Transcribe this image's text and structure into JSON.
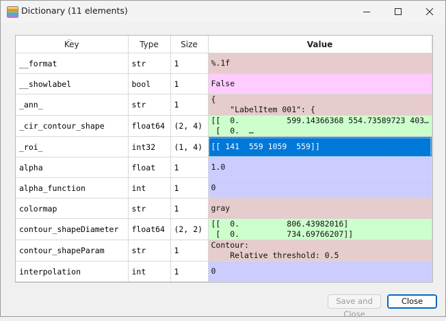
{
  "window": {
    "title": "Dictionary (11 elements)",
    "minimize_icon": "minimize-icon",
    "maximize_icon": "maximize-icon",
    "close_icon": "close-icon"
  },
  "table": {
    "headers": {
      "key": "Key",
      "type": "Type",
      "size": "Size",
      "value": "Value"
    },
    "rows": [
      {
        "key": "__format",
        "type": "str",
        "size": "1",
        "value": [
          "%.1f"
        ],
        "bg": "#e6cccc"
      },
      {
        "key": "__showlabel",
        "type": "bool",
        "size": "1",
        "value": [
          "False"
        ],
        "bg": "#ffccff"
      },
      {
        "key": "_ann_",
        "type": "str",
        "size": "1",
        "value": [
          "{",
          "    \"LabelItem 001\": {"
        ],
        "bg": "#e6cccc"
      },
      {
        "key": "_cir_contour_shape",
        "type": "float64",
        "size": "(2, 4)",
        "value": [
          "[[  0.          599.14366368 554.73589723 403…",
          " [  0.  …"
        ],
        "bg": "#ccffcc"
      },
      {
        "key": "_roi_",
        "type": "int32",
        "size": "(1, 4)",
        "value": [
          "[[ 141  559 1059  559]]"
        ],
        "bg": "#0078d7",
        "selected": true
      },
      {
        "key": "alpha",
        "type": "float",
        "size": "1",
        "value": [
          "1.0"
        ],
        "bg": "#ccccff"
      },
      {
        "key": "alpha_function",
        "type": "int",
        "size": "1",
        "value": [
          "0"
        ],
        "bg": "#ccccff"
      },
      {
        "key": "colormap",
        "type": "str",
        "size": "1",
        "value": [
          "gray"
        ],
        "bg": "#e6cccc"
      },
      {
        "key": "contour_shapeDiameter",
        "type": "float64",
        "size": "(2, 2)",
        "value": [
          "[[  0.          806.43982016]",
          " [  0.          734.69766207]]"
        ],
        "bg": "#ccffcc"
      },
      {
        "key": "contour_shapeParam",
        "type": "str",
        "size": "1",
        "value": [
          "Contour:",
          "    Relative threshold: 0.5"
        ],
        "bg": "#e6cccc"
      },
      {
        "key": "interpolation",
        "type": "int",
        "size": "1",
        "value": [
          "0"
        ],
        "bg": "#ccccff"
      }
    ]
  },
  "buttons": {
    "save_and_close": "Save and Close",
    "close": "Close"
  },
  "colors": {
    "accent": "#0078d7"
  }
}
